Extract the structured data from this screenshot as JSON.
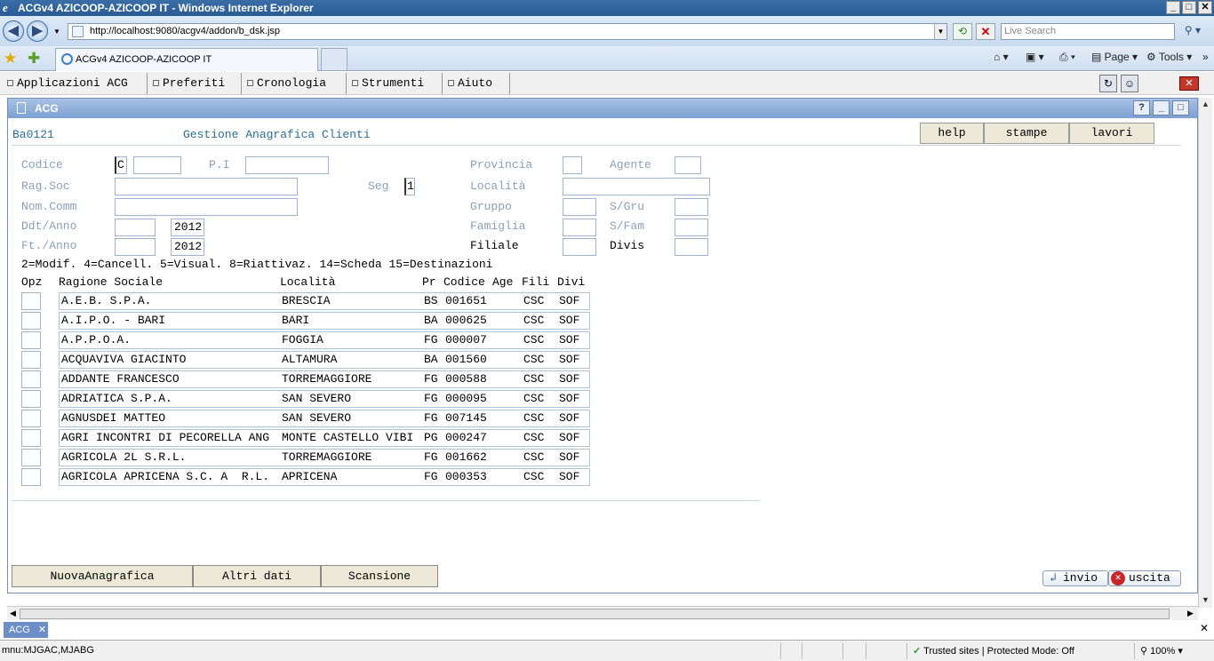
{
  "window": {
    "title": "ACGv4 AZICOOP-AZICOOP IT - Windows Internet Explorer",
    "min": "_",
    "max": "□",
    "close": "✕"
  },
  "browser": {
    "url": "http://localhost:9080/acgv4/addon/b_dsk.jsp",
    "search_placeholder": "Live Search",
    "tab_title": "ACGv4 AZICOOP-AZICOOP IT",
    "page_label": "Page",
    "tools_label": "Tools"
  },
  "menu": {
    "items": [
      "Applicazioni ACG",
      "Preferiti",
      "Cronologia",
      "Strumenti",
      "Aiuto"
    ]
  },
  "inner": {
    "title": "ACG",
    "help": "?"
  },
  "form": {
    "code": "Ba0121",
    "heading": "Gestione Anagrafica Clienti",
    "buttons": [
      "help",
      "stampe",
      "lavori"
    ],
    "labels": {
      "codice": "Codice",
      "pi": "P.I",
      "provincia": "Provincia",
      "agente": "Agente",
      "ragsoc": "Rag.Soc",
      "seg": "Seg",
      "localita": "Località",
      "nomcomm": "Nom.Comm",
      "gruppo": "Gruppo",
      "sgru": "S/Gru",
      "ddtanno": "Ddt/Anno",
      "famiglia": "Famiglia",
      "sfam": "S/Fam",
      "ftanno": "Ft./Anno",
      "filiale": "Filiale",
      "divis": "Divis"
    },
    "values": {
      "codice_prefix": "C",
      "seg": "1",
      "ddt_year": "2012",
      "ft_year": "2012"
    },
    "legend": "2=Modif. 4=Cancell. 5=Visual. 8=Riattivaz. 14=Scheda 15=Destinazioni"
  },
  "table": {
    "headers": {
      "opz": "Opz",
      "ragione": "Ragione Sociale",
      "localita": "Località",
      "pr": "Pr",
      "codice": "Codice",
      "age": "Age",
      "fili": "Fili",
      "divi": "Divi"
    },
    "rows": [
      {
        "ragione": "A.E.B. S.P.A.",
        "localita": "BRESCIA",
        "pr": "BS",
        "codice": "001651",
        "fili": "CSC",
        "divi": "SOF"
      },
      {
        "ragione": "A.I.P.O. - BARI",
        "localita": "BARI",
        "pr": "BA",
        "codice": "000625",
        "fili": "CSC",
        "divi": "SOF"
      },
      {
        "ragione": "A.P.P.O.A.",
        "localita": "FOGGIA",
        "pr": "FG",
        "codice": "000007",
        "fili": "CSC",
        "divi": "SOF"
      },
      {
        "ragione": "ACQUAVIVA GIACINTO",
        "localita": "ALTAMURA",
        "pr": "BA",
        "codice": "001560",
        "fili": "CSC",
        "divi": "SOF"
      },
      {
        "ragione": "ADDANTE FRANCESCO",
        "localita": "TORREMAGGIORE",
        "pr": "FG",
        "codice": "000588",
        "fili": "CSC",
        "divi": "SOF"
      },
      {
        "ragione": "ADRIATICA S.P.A.",
        "localita": "SAN SEVERO",
        "pr": "FG",
        "codice": "000095",
        "fili": "CSC",
        "divi": "SOF"
      },
      {
        "ragione": "AGNUSDEI MATTEO",
        "localita": "SAN SEVERO",
        "pr": "FG",
        "codice": "007145",
        "fili": "CSC",
        "divi": "SOF"
      },
      {
        "ragione": "AGRI INCONTRI DI PECORELLA ANG",
        "localita": "MONTE CASTELLO VIBI",
        "pr": "PG",
        "codice": "000247",
        "fili": "CSC",
        "divi": "SOF"
      },
      {
        "ragione": "AGRICOLA 2L S.R.L.",
        "localita": "TORREMAGGIORE",
        "pr": "FG",
        "codice": "001662",
        "fili": "CSC",
        "divi": "SOF"
      },
      {
        "ragione": "AGRICOLA APRICENA S.C. A  R.L.",
        "localita": "APRICENA",
        "pr": "FG",
        "codice": "000353",
        "fili": "CSC",
        "divi": "SOF"
      }
    ]
  },
  "bottom": {
    "buttons": [
      "NuovaAnagrafica",
      "Altri dati",
      "Scansione"
    ],
    "invio": "invio",
    "uscita": "uscita"
  },
  "taskbar": {
    "tab": "ACG"
  },
  "status": {
    "left": "mnu:MJGAC,MJABG",
    "trust": "Trusted sites | Protected Mode: Off",
    "zoom": "100%"
  },
  "colors": {
    "title_bar": "#2a5a95",
    "inner_title": "#7c9fd2",
    "label_blue": "#8aa0ba"
  }
}
